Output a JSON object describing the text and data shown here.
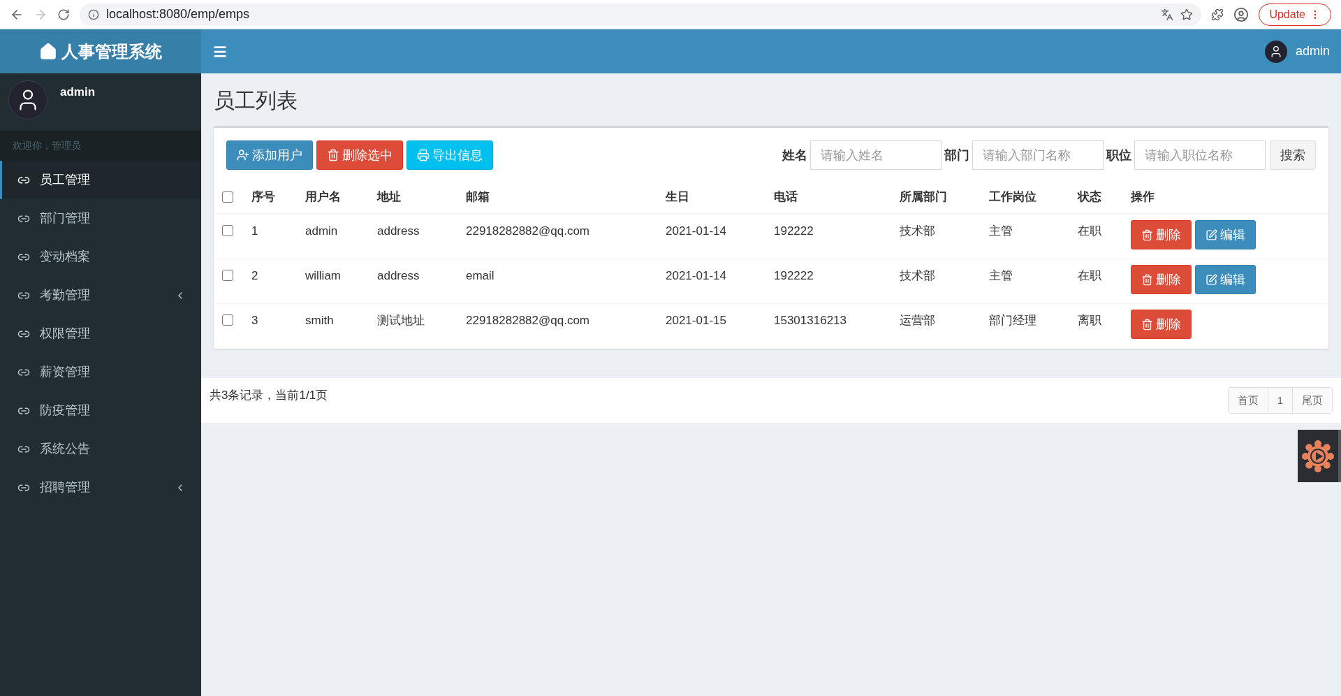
{
  "browser": {
    "url": "localhost:8080/emp/emps",
    "update_button": "Update"
  },
  "header": {
    "logo": "人事管理系统",
    "user": "admin"
  },
  "sidebar": {
    "user": "admin",
    "welcome": "欢迎你，管理员",
    "items": [
      {
        "label": "员工管理",
        "selected": true,
        "expandable": false
      },
      {
        "label": "部门管理",
        "selected": false,
        "expandable": false
      },
      {
        "label": "变动档案",
        "selected": false,
        "expandable": false
      },
      {
        "label": "考勤管理",
        "selected": false,
        "expandable": true
      },
      {
        "label": "权限管理",
        "selected": false,
        "expandable": false
      },
      {
        "label": "薪资管理",
        "selected": false,
        "expandable": false
      },
      {
        "label": "防疫管理",
        "selected": false,
        "expandable": false
      },
      {
        "label": "系统公告",
        "selected": false,
        "expandable": false
      },
      {
        "label": "招聘管理",
        "selected": false,
        "expandable": true
      }
    ]
  },
  "page_title": "员工列表",
  "toolbar": {
    "buttons": [
      {
        "kind": "add",
        "label": "添加用户"
      },
      {
        "kind": "delete",
        "label": "删除选中"
      },
      {
        "kind": "export",
        "label": "导出信息"
      }
    ],
    "filters": [
      {
        "label": "姓名",
        "placeholder": "请输入姓名"
      },
      {
        "label": "部门",
        "placeholder": "请输入部门名称"
      },
      {
        "label": "职位",
        "placeholder": "请输入职位名称"
      }
    ],
    "search_button": "搜索"
  },
  "table": {
    "select_all": {
      "checked": false
    },
    "columns": [
      "序号",
      "用户名",
      "地址",
      "邮箱",
      "生日",
      "电话",
      "所属部门",
      "工作岗位",
      "状态",
      "操作"
    ],
    "rows": [
      {
        "checked": false,
        "cells": [
          "1",
          "admin",
          "address",
          "22918282882@qq.com",
          "2021-01-14",
          "192222",
          "技术部",
          "主管",
          "在职"
        ],
        "actions": [
          {
            "kind": "delete",
            "label": "删除"
          },
          {
            "kind": "edit",
            "label": "编辑"
          }
        ]
      },
      {
        "checked": false,
        "cells": [
          "2",
          "william",
          "address",
          "email",
          "2021-01-14",
          "192222",
          "技术部",
          "主管",
          "在职"
        ],
        "actions": [
          {
            "kind": "delete",
            "label": "删除"
          },
          {
            "kind": "edit",
            "label": "编辑"
          }
        ]
      },
      {
        "checked": false,
        "cells": [
          "3",
          "smith",
          "测试地址",
          "22918282882@qq.com",
          "2021-01-15",
          "15301316213",
          "运营部",
          "部门经理",
          "离职"
        ],
        "actions": [
          {
            "kind": "delete",
            "label": "删除"
          }
        ]
      }
    ]
  },
  "footer": {
    "summary": "共3条记录，当前1/1页",
    "pagination": [
      {
        "label": "首页"
      },
      {
        "label": "1"
      },
      {
        "label": "尾页"
      }
    ]
  }
}
